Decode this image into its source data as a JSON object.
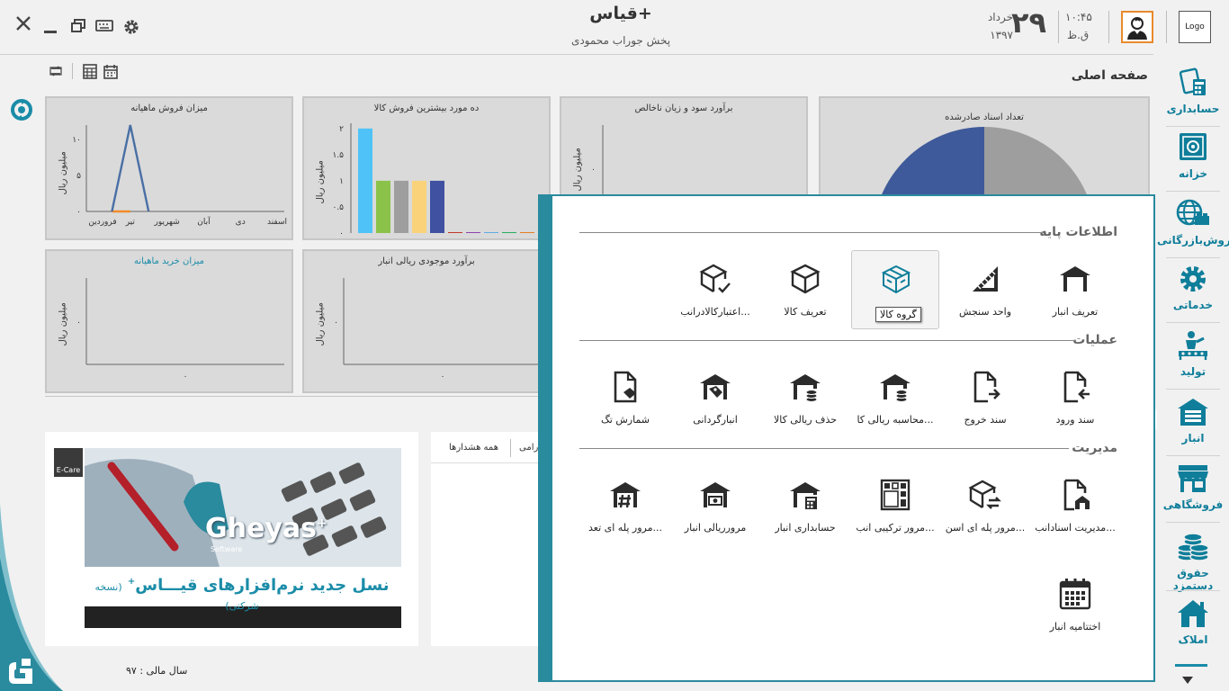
{
  "app": {
    "title": "قیاس+",
    "company": "پخش جوراب محمودی",
    "logo_text": "Logo",
    "page_title": "صفحه اصلی",
    "fiscal_year": "سال مالی : ۹۷"
  },
  "date": {
    "day": "۲۹",
    "month": "خرداد",
    "year": "۱۳۹۷",
    "time": "۱۰:۴۵",
    "ampm": "ق.ظ"
  },
  "colors": {
    "accent": "#2a8a9e",
    "sidebar_label": "#0f7e9a",
    "avatar_border": "#e98a2c"
  },
  "sidebar": {
    "items": [
      {
        "label": "حسابداری",
        "icon": "calculator-icon"
      },
      {
        "label": "خزانه",
        "icon": "safe-icon"
      },
      {
        "label": "فروش‌بازرگانی",
        "icon": "globe-icon"
      },
      {
        "label": "خدماتی",
        "icon": "gear-icon"
      },
      {
        "label": "تولید",
        "icon": "worker-icon"
      },
      {
        "label": "انبار",
        "icon": "warehouse-icon"
      },
      {
        "label": "فروشگاهی",
        "icon": "shop-icon"
      },
      {
        "label": "حقوق دستمزد",
        "icon": "coins-icon"
      },
      {
        "label": "املاک",
        "icon": "house-icon"
      }
    ]
  },
  "charts": {
    "monthly_sales": {
      "title": "میزان فروش ماهیانه",
      "ylabel": "میلیون ریال"
    },
    "top_products": {
      "title": "ده مورد بیشترین فروش کالا",
      "ylabel": "میلیون ریال"
    },
    "profit_loss": {
      "title": "برآورد سود و زیان ناخالص",
      "ylabel": "میلیون ریال"
    },
    "documents": {
      "title": "تعداد اسناد صادرشده"
    },
    "monthly_purchase": {
      "title": "میزان خرید ماهیانه",
      "ylabel": "میلیون ریال"
    },
    "inventory_value": {
      "title": "برآورد موجودی ریالی انبار",
      "ylabel": "میلیون ریال"
    }
  },
  "chart_data": [
    {
      "type": "line",
      "title": "میزان فروش ماهیانه",
      "ylabel": "میلیون ریال",
      "categories": [
        "فروردین",
        "",
        "تیر",
        "",
        "شهریور",
        "",
        "آبان",
        "",
        "دی",
        "",
        "اسفند"
      ],
      "category_ticks": [
        "اسفند",
        "دی",
        "آبان",
        "شهریور",
        "تیر",
        "فروردین"
      ],
      "yticks": [
        "۰",
        "۵",
        "۱۰"
      ],
      "ylim": [
        0,
        12
      ],
      "series": [
        {
          "values": [
            0,
            0,
            12,
            0,
            0,
            0,
            0,
            0,
            0,
            0,
            0
          ],
          "color": "#4a6fa5"
        },
        {
          "values": [
            0,
            0,
            0,
            0,
            0,
            0,
            0,
            0,
            0,
            0,
            0
          ],
          "color": "#f28c28"
        }
      ]
    },
    {
      "type": "bar",
      "title": "ده مورد بیشترین فروش کالا",
      "ylabel": "میلیون ریال",
      "yticks": [
        "۰",
        "۰.۵",
        "۱",
        "۱.۵",
        "۲"
      ],
      "ylim": [
        0,
        2.1
      ],
      "values": [
        2,
        1,
        1,
        1,
        1,
        0,
        0,
        0,
        0,
        0
      ],
      "colors": [
        "#4fc3f7",
        "#8bc34a",
        "#9e9e9e",
        "#f9d27a",
        "#3f51a0",
        "#c0392b",
        "#8e44ad",
        "#5dade2",
        "#27ae60",
        "#e67e22"
      ]
    },
    {
      "type": "line",
      "title": "برآورد سود و زیان ناخالص",
      "ylabel": "میلیون ریال",
      "yticks": [
        "۰"
      ]
    },
    {
      "type": "pie",
      "title": "تعداد اسناد صادرشده",
      "values": [
        50,
        50
      ],
      "colors": [
        "#3f5a9a",
        "#9e9e9e"
      ]
    },
    {
      "type": "line",
      "title": "میزان خرید ماهیانه",
      "ylabel": "میلیون ریال",
      "yticks": [
        "۰"
      ],
      "xticks": [
        "۰"
      ]
    },
    {
      "type": "line",
      "title": "برآورد موجودی ریالی انبار",
      "ylabel": "میلیون ریال",
      "yticks": [
        "۰"
      ],
      "xticks": [
        "۰"
      ]
    }
  ],
  "panel2": {
    "tab_all": "همه هشدارها",
    "tab_partial": "رامی"
  },
  "banner": {
    "brand": "Gheyas",
    "brand_sub": "Software",
    "ecare": "E-Care",
    "tagline": "نسل جدید نرم‌افزارهای قیـــاس",
    "tagline_note": "(نسخه شرکتی)"
  },
  "popup": {
    "sections": [
      {
        "title": "اطلاعات پایه",
        "items": [
          {
            "label": "تعریف انبار",
            "icon": "warehouse-icon"
          },
          {
            "label": "واحد سنجش",
            "icon": "ruler-icon"
          },
          {
            "label": "گروه کالا",
            "icon": "boxes-icon",
            "tooltip": "گروه کالا"
          },
          {
            "label": "تعریف کالا",
            "icon": "box-icon"
          },
          {
            "label": "اعتبارکالادرانب...",
            "icon": "box-check-icon"
          }
        ]
      },
      {
        "title": "عملیات",
        "items": [
          {
            "label": "سند ورود",
            "icon": "doc-in-icon"
          },
          {
            "label": "سند خروج",
            "icon": "doc-out-icon"
          },
          {
            "label": "محاسبه ریالی کا...",
            "icon": "warehouse-coins-icon"
          },
          {
            "label": "حذف ریالی کالا",
            "icon": "warehouse-coins-icon"
          },
          {
            "label": "انبارگردانی",
            "icon": "warehouse-tag-icon"
          },
          {
            "label": "شمارش تگ",
            "icon": "doc-tag-icon"
          }
        ]
      },
      {
        "title": "مدیریت",
        "items": [
          {
            "label": "مدیریت اسنادانب...",
            "icon": "doc-warehouse-icon"
          },
          {
            "label": "مرور پله ای اسن...",
            "icon": "box-refresh-icon"
          },
          {
            "label": "مرور ترکیبی انب...",
            "icon": "grid-icon"
          },
          {
            "label": "حسابداری انبار",
            "icon": "warehouse-calc-icon"
          },
          {
            "label": "مرورریالی انبار",
            "icon": "warehouse-cash-icon"
          },
          {
            "label": "مرور پله ای تعد...",
            "icon": "warehouse-hash-icon"
          },
          {
            "label": "اختتامیه انبار",
            "icon": "calendar-icon"
          }
        ]
      }
    ]
  }
}
